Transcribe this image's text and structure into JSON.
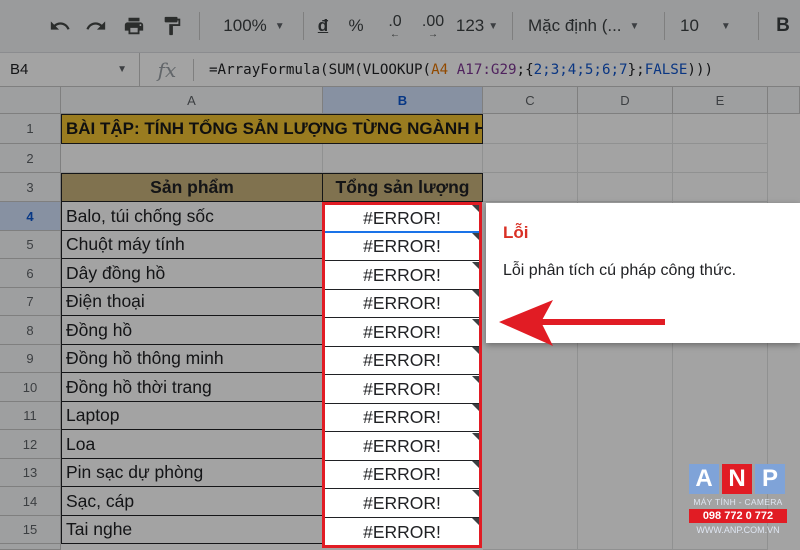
{
  "toolbar": {
    "zoom": "100%",
    "currency": "đ",
    "percent": "%",
    "dec_decrease": ".0",
    "dec_increase": ".00",
    "more_formats": "123",
    "font": "Mặc định (...",
    "font_size": "10",
    "bold": "B"
  },
  "formula_bar": {
    "name_box": "B4",
    "fx": "fx",
    "part1": "=ArrayFormula(SUM(VLOOKUP(",
    "ref_a4": "A4",
    "ref_range": "A17:G29",
    "sep": ";",
    "open_brace": "{",
    "array": "2;3;4;5;6;7",
    "close_brace": "}",
    "semi": ";",
    "false_kw": "FALSE",
    "closing": ")))"
  },
  "columns": [
    "A",
    "B",
    "C",
    "D",
    "E"
  ],
  "rows": [
    "1",
    "2",
    "3",
    "4",
    "5",
    "6",
    "7",
    "8",
    "9",
    "10",
    "11",
    "12",
    "13",
    "14",
    "15"
  ],
  "sheet": {
    "title": "BÀI TẬP: TÍNH TỔNG SẢN LƯỢNG TỪNG NGÀNH HÀNG",
    "header_product": "Sản phẩm",
    "header_total": "Tổng sản lượng",
    "products": [
      "Balo, túi chống sốc",
      "Chuột máy tính",
      "Dây đồng hồ",
      "Điện thoại",
      "Đồng hồ",
      "Đồng hồ thông minh",
      "Đồng hồ thời trang",
      "Laptop",
      "Loa",
      "Pin sạc dự phòng",
      "Sạc, cáp",
      "Tai nghe"
    ],
    "error_value": "#ERROR!"
  },
  "tooltip": {
    "title": "Lỗi",
    "message": "Lỗi phân tích cú pháp công thức."
  },
  "logo": {
    "letters": [
      "A",
      "N",
      "P"
    ],
    "tagline": "MÁY TÍNH - CAMERA",
    "phone": "098 772 0 772",
    "website": "WWW.ANP.COM.VN"
  },
  "colors": {
    "title_fill": "#f1c232",
    "header_fill": "#c9b27c",
    "highlight": "#e11c24",
    "error_text": "#d93025"
  }
}
